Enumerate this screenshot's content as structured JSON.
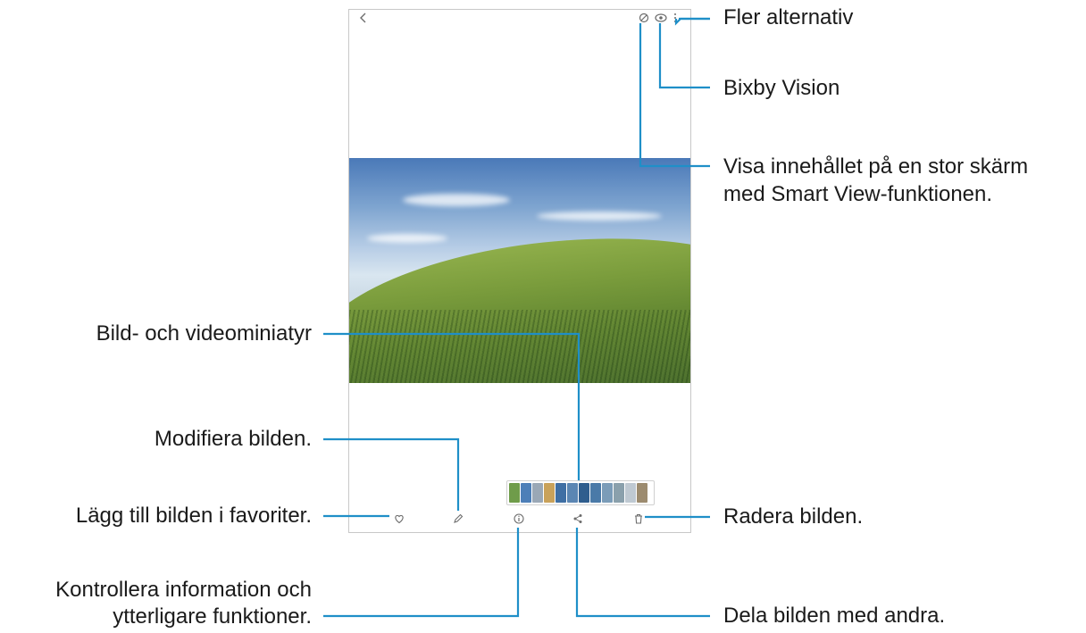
{
  "callouts": {
    "more_options": "Fler alternativ",
    "bixby_vision": "Bixby Vision",
    "smart_view_line1": "Visa innehållet på en stor skärm",
    "smart_view_line2": "med Smart View-funktionen.",
    "thumbnails": "Bild- och videominiatyr",
    "edit": "Modifiera bilden.",
    "favorite": "Lägg till bilden i favoriter.",
    "delete": "Radera bilden.",
    "details_line1": "Kontrollera information och",
    "details_line2": "ytterligare funktioner.",
    "share": "Dela bilden med andra."
  },
  "toolbar_icons": {
    "back": "back-arrow-icon",
    "smart_view": "smart-view-icon",
    "bixby_vision": "eye-icon",
    "more": "more-vertical-icon"
  },
  "bottom_icons": [
    "heart-icon",
    "pencil-icon",
    "info-icon",
    "share-icon",
    "trash-icon"
  ],
  "thumbnail_colors": [
    "#6f9c4a",
    "#4d7fb8",
    "#9aa8b6",
    "#c9a25a",
    "#3f6fa4",
    "#5b86b3",
    "#2f5e8e",
    "#4a7aa8",
    "#7b9cb8",
    "#8aa0ac",
    "#bfc9d2",
    "#9c8b6f"
  ],
  "colors": {
    "callout_line": "#1f8fc8",
    "icon": "#6c6c6c",
    "frame": "#c8c8c8"
  }
}
